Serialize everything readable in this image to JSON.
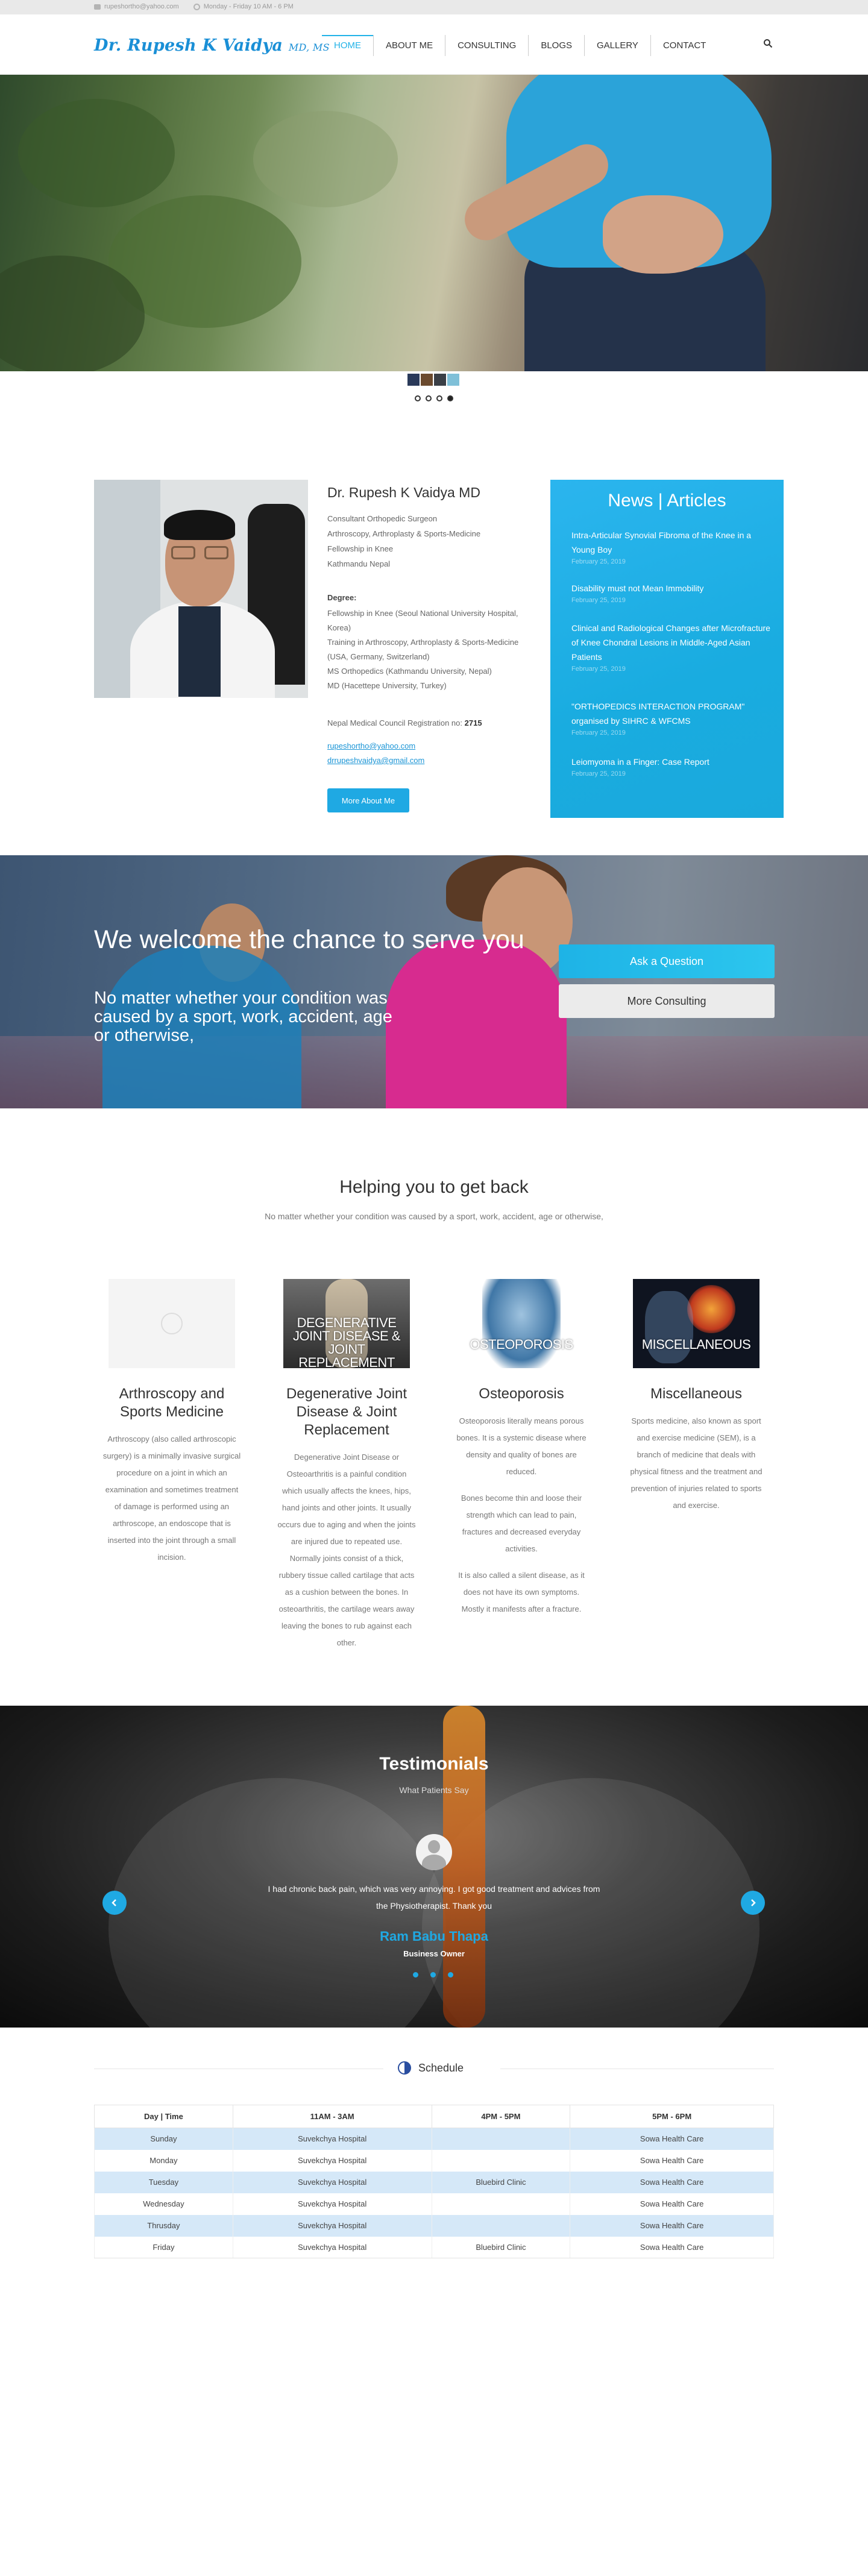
{
  "topbar": {
    "email": "rupeshortho@yahoo.com",
    "hours": "Monday - Friday 10 AM - 6 PM"
  },
  "logo": {
    "name": "Dr. Rupesh K Vaidya",
    "degree": "MD, MS"
  },
  "nav": {
    "items": [
      "HOME",
      "ABOUT ME",
      "CONSULTING",
      "BLOGS",
      "GALLERY",
      "CONTACT"
    ],
    "active": "HOME"
  },
  "hero": {
    "slides_total": 4,
    "active_slide": 4
  },
  "about": {
    "name": "Dr. Rupesh K Vaidya MD",
    "lines": [
      "Consultant Orthopedic Surgeon",
      "Arthroscopy, Arthroplasty & Sports-Medicine",
      "Fellowship in Knee",
      "Kathmandu Nepal"
    ],
    "degree_heading": "Degree:",
    "degree_lines": [
      "Fellowship in Knee (Seoul National University Hospital, Korea)",
      "Training in Arthroscopy, Arthroplasty & Sports-Medicine (USA, Germany, Switzerland)",
      "MS Orthopedics (Kathmandu University, Nepal)",
      "MD (Hacettepe University, Turkey)"
    ],
    "registration_label": "Nepal Medical Council Registration no:",
    "registration_no": "2715",
    "emails": [
      "rupeshortho@yahoo.com",
      "drrupeshvaidya@gmail.com"
    ],
    "button": "More About Me"
  },
  "news": {
    "title": "News | Articles",
    "items": [
      {
        "title": "Intra-Articular Synovial Fibroma of the Knee in a Young Boy",
        "date": "February 25, 2019"
      },
      {
        "title": "Disability must not Mean Immobility",
        "date": "February 25, 2019"
      },
      {
        "title": "Clinical and Radiological Changes after Microfracture of Knee Chondral Lesions in Middle-Aged Asian Patients",
        "date": "February 25, 2019"
      },
      {
        "title": "\"ORTHOPEDICS INTERACTION PROGRAM\" organised by SIHRC & WFCMS",
        "date": "February 25, 2019"
      },
      {
        "title": "Leiomyoma in a Finger: Case Report",
        "date": "February 25, 2019"
      }
    ]
  },
  "welcome": {
    "heading": "We welcome the chance to serve you",
    "subheading": "No matter whether your condition was caused by a sport, work, accident, age or otherwise,",
    "ask_button": "Ask a Question",
    "consult_button": "More Consulting"
  },
  "helping": {
    "title": "Helping you to get back",
    "subtitle": "No matter whether your condition was caused by a sport, work, accident, age or otherwise,",
    "cards": [
      {
        "image_caption": "",
        "title": "Arthroscopy and Sports Medicine",
        "paragraphs": [
          "Arthroscopy (also called arthroscopic surgery) is a minimally invasive surgical procedure on a joint in which an examination and sometimes treatment of damage is performed using an arthroscope, an endoscope that is inserted into the joint through a small incision."
        ]
      },
      {
        "image_caption": "DEGENERATIVE JOINT DISEASE & JOINT REPLACEMENT",
        "title": "Degenerative Joint Disease & Joint Replacement",
        "paragraphs": [
          "Degenerative Joint Disease or Osteoarthritis is a painful condition which usually affects the knees, hips, hand joints and other joints. It usually occurs due to aging and when the joints are injured due to repeated use. Normally joints consist of a thick, rubbery tissue called cartilage that acts as a cushion between the bones. In osteoarthritis, the cartilage wears away leaving the bones to rub against each other."
        ]
      },
      {
        "image_caption": "OSTEOPOROSIS",
        "title": "Osteoporosis",
        "paragraphs": [
          "Osteoporosis literally means porous bones. It is a systemic disease where density and quality of bones are reduced.",
          "Bones become thin and loose their strength which can lead to pain, fractures and decreased everyday activities.",
          "It is also called a silent disease, as it does not have its own symptoms. Mostly it manifests after a fracture."
        ]
      },
      {
        "image_caption": "MISCELLANEOUS",
        "title": "Miscellaneous",
        "paragraphs": [
          "Sports medicine, also known as sport and exercise medicine (SEM), is a branch of medicine that deals with physical fitness and the treatment and prevention of injuries related to sports and exercise."
        ]
      }
    ]
  },
  "testimonials": {
    "title": "Testimonials",
    "subtitle": "What Patients Say",
    "quote": "I had chronic back pain, which was very annoying. I got good treatment and advices from the Physiotherapist. Thank you",
    "name": "Ram Babu Thapa",
    "role": "Business Owner",
    "dots": 3
  },
  "schedule": {
    "title": "Schedule",
    "headers": [
      "Day | Time",
      "11AM - 3AM",
      "4PM - 5PM",
      "5PM - 6PM"
    ],
    "rows": [
      [
        "Sunday",
        "Suvekchya Hospital",
        "",
        "Sowa Health Care"
      ],
      [
        "Monday",
        "Suvekchya Hospital",
        "",
        "Sowa Health Care"
      ],
      [
        "Tuesday",
        "Suvekchya Hospital",
        "Bluebird Clinic",
        "Sowa Health Care"
      ],
      [
        "Wednesday",
        "Suvekchya Hospital",
        "",
        "Sowa Health Care"
      ],
      [
        "Thrusday",
        "Suvekchya Hospital",
        "",
        "Sowa Health Care"
      ],
      [
        "Friday",
        "Suvekchya Hospital",
        "Bluebird Clinic",
        "Sowa Health Care"
      ]
    ]
  },
  "colors": {
    "accent": "#1fa9e3",
    "logo": "#1a8fd6",
    "schedule_alt_row": "#d5e8f8"
  }
}
